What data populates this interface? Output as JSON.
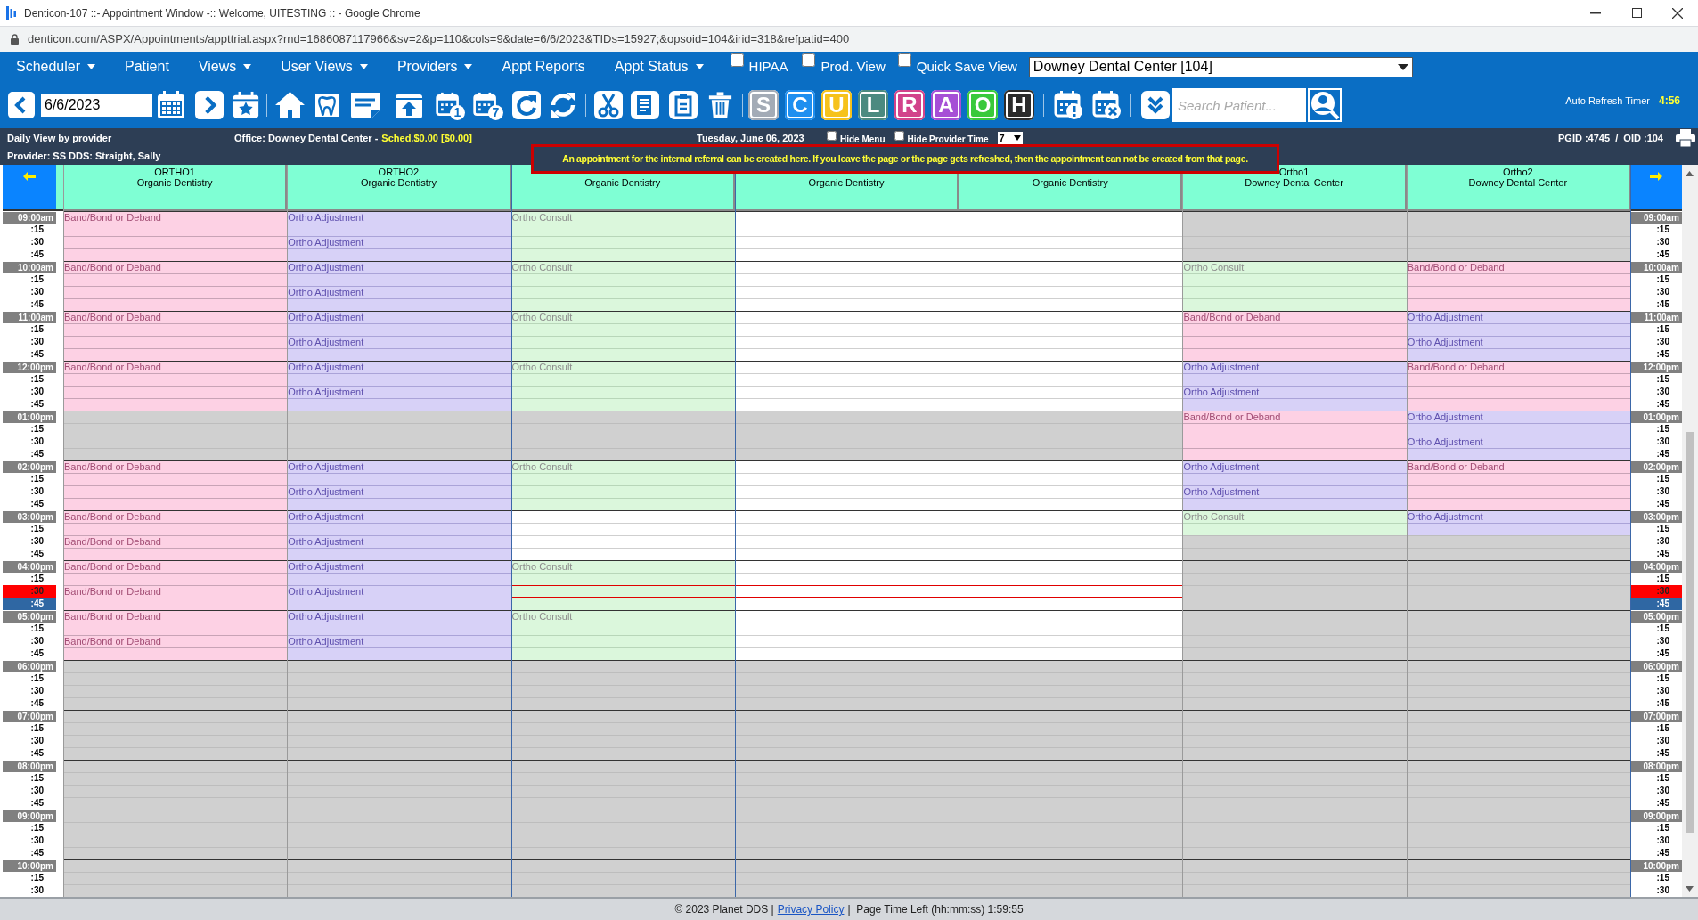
{
  "window": {
    "title": "Denticon-107 ::- Appointment Window -:: Welcome, UITESTING :: - Google Chrome",
    "url": "denticon.com/ASPX/Appointments/appttrial.aspx?rnd=1686087117966&sv=2&p=110&cols=9&date=6/6/2023&TIDs=15927;&opsoid=104&irid=318&refpatid=400"
  },
  "menu": [
    {
      "label": "Scheduler",
      "dropdown": true
    },
    {
      "label": "Patient",
      "dropdown": false
    },
    {
      "label": "Views",
      "dropdown": true
    },
    {
      "label": "User Views",
      "dropdown": true
    },
    {
      "label": "Providers",
      "dropdown": true
    },
    {
      "label": "Appt Reports",
      "dropdown": false
    },
    {
      "label": "Appt Status",
      "dropdown": true
    }
  ],
  "menu_checks": [
    {
      "label": "HIPAA",
      "checked": false
    },
    {
      "label": "Prod. View",
      "checked": false
    },
    {
      "label": "Quick Save View",
      "checked": false
    }
  ],
  "office_select": {
    "value": "Downey Dental Center [104]"
  },
  "toolbar": {
    "date": "6/6/2023",
    "day_badges": [
      "1",
      "7"
    ],
    "letters": [
      {
        "letter": "S",
        "color": "#a3abb6"
      },
      {
        "letter": "C",
        "color": "#1e8ff0"
      },
      {
        "letter": "U",
        "color": "#f6c21c"
      },
      {
        "letter": "L",
        "color": "#4b8a80"
      },
      {
        "letter": "R",
        "color": "#d2438b"
      },
      {
        "letter": "A",
        "color": "#a64fd6"
      },
      {
        "letter": "O",
        "color": "#39c93c"
      },
      {
        "letter": "H",
        "color": "#2b2b2b"
      }
    ],
    "search": {
      "placeholder": "Search Patient..."
    },
    "refresh_label": "Auto Refresh Timer",
    "refresh_value": "4:56"
  },
  "info": {
    "view": "Daily View by provider",
    "office": "Office: Downey Dental Center -",
    "sched": "Sched.$0.00 [$0.00]",
    "date": "Tuesday, June 06, 2023",
    "options": [
      {
        "label": "Hide Menu",
        "checked": false
      },
      {
        "label": "Hide Provider Time",
        "checked": false
      }
    ],
    "days": "7",
    "ids": "PGID :4745  /  OID :104",
    "provider": "Provider: SS DDS: Straight, Sally",
    "notice": "An appointment for the internal referral can be created here. If you leave the page or the page gets refreshed, then the appointment can not be created from that page."
  },
  "time_columns": [
    {
      "kind": "left",
      "hours": [
        {
          "label": "09:00am",
          "subs": [
            {
              "label": ":15",
              "kind": "plain"
            },
            {
              "label": ":30",
              "kind": "plain"
            },
            {
              "label": ":45",
              "kind": "plain"
            }
          ]
        },
        {
          "label": "10:00am",
          "subs": [
            {
              "label": ":15",
              "kind": "plain"
            },
            {
              "label": ":30",
              "kind": "plain"
            },
            {
              "label": ":45",
              "kind": "plain"
            }
          ]
        },
        {
          "label": "11:00am",
          "subs": [
            {
              "label": ":15",
              "kind": "plain"
            },
            {
              "label": ":30",
              "kind": "plain"
            },
            {
              "label": ":45",
              "kind": "plain"
            }
          ]
        },
        {
          "label": "12:00pm",
          "subs": [
            {
              "label": ":15",
              "kind": "plain"
            },
            {
              "label": ":30",
              "kind": "plain"
            },
            {
              "label": ":45",
              "kind": "plain"
            }
          ]
        },
        {
          "label": "01:00pm",
          "subs": [
            {
              "label": ":15",
              "kind": "plain"
            },
            {
              "label": ":30",
              "kind": "plain"
            },
            {
              "label": ":45",
              "kind": "plain"
            }
          ]
        },
        {
          "label": "02:00pm",
          "subs": [
            {
              "label": ":15",
              "kind": "plain"
            },
            {
              "label": ":30",
              "kind": "plain"
            },
            {
              "label": ":45",
              "kind": "plain"
            }
          ]
        },
        {
          "label": "03:00pm",
          "subs": [
            {
              "label": ":15",
              "kind": "plain"
            },
            {
              "label": ":30",
              "kind": "plain"
            },
            {
              "label": ":45",
              "kind": "plain"
            }
          ]
        },
        {
          "label": "04:00pm",
          "subs": [
            {
              "label": ":15",
              "kind": "plain"
            },
            {
              "label": ":30",
              "kind": "now"
            },
            {
              "label": ":45",
              "kind": "next"
            }
          ]
        },
        {
          "label": "05:00pm",
          "subs": [
            {
              "label": ":15",
              "kind": "plain"
            },
            {
              "label": ":30",
              "kind": "plain"
            },
            {
              "label": ":45",
              "kind": "plain"
            }
          ]
        },
        {
          "label": "06:00pm",
          "subs": [
            {
              "label": ":15",
              "kind": "plain"
            },
            {
              "label": ":30",
              "kind": "plain"
            },
            {
              "label": ":45",
              "kind": "plain"
            }
          ]
        },
        {
          "label": "07:00pm",
          "subs": [
            {
              "label": ":15",
              "kind": "plain"
            },
            {
              "label": ":30",
              "kind": "plain"
            },
            {
              "label": ":45",
              "kind": "plain"
            }
          ]
        },
        {
          "label": "08:00pm",
          "subs": [
            {
              "label": ":15",
              "kind": "plain"
            },
            {
              "label": ":30",
              "kind": "plain"
            },
            {
              "label": ":45",
              "kind": "plain"
            }
          ]
        },
        {
          "label": "09:00pm",
          "subs": [
            {
              "label": ":15",
              "kind": "plain"
            },
            {
              "label": ":30",
              "kind": "plain"
            },
            {
              "label": ":45",
              "kind": "plain"
            }
          ]
        },
        {
          "label": "10:00pm",
          "subs": [
            {
              "label": ":15",
              "kind": "plain"
            },
            {
              "label": ":30",
              "kind": "plain"
            }
          ]
        }
      ]
    },
    {
      "kind": "right",
      "hours": [
        {
          "label": "09:00am",
          "subs": [
            {
              "label": ":15",
              "kind": "plain"
            },
            {
              "label": ":30",
              "kind": "plain"
            },
            {
              "label": ":45",
              "kind": "plain"
            }
          ]
        },
        {
          "label": "10:00am",
          "subs": [
            {
              "label": ":15",
              "kind": "plain"
            },
            {
              "label": ":30",
              "kind": "plain"
            },
            {
              "label": ":45",
              "kind": "plain"
            }
          ]
        },
        {
          "label": "11:00am",
          "subs": [
            {
              "label": ":15",
              "kind": "plain"
            },
            {
              "label": ":30",
              "kind": "plain"
            },
            {
              "label": ":45",
              "kind": "plain"
            }
          ]
        },
        {
          "label": "12:00pm",
          "subs": [
            {
              "label": ":15",
              "kind": "plain"
            },
            {
              "label": ":30",
              "kind": "plain"
            },
            {
              "label": ":45",
              "kind": "plain"
            }
          ]
        },
        {
          "label": "01:00pm",
          "subs": [
            {
              "label": ":15",
              "kind": "plain"
            },
            {
              "label": ":30",
              "kind": "plain"
            },
            {
              "label": ":45",
              "kind": "plain"
            }
          ]
        },
        {
          "label": "02:00pm",
          "subs": [
            {
              "label": ":15",
              "kind": "plain"
            },
            {
              "label": ":30",
              "kind": "plain"
            },
            {
              "label": ":45",
              "kind": "plain"
            }
          ]
        },
        {
          "label": "03:00pm",
          "subs": [
            {
              "label": ":15",
              "kind": "plain"
            },
            {
              "label": ":30",
              "kind": "plain"
            },
            {
              "label": ":45",
              "kind": "plain"
            }
          ]
        },
        {
          "label": "04:00pm",
          "subs": [
            {
              "label": ":15",
              "kind": "plain"
            },
            {
              "label": ":30",
              "kind": "now"
            },
            {
              "label": ":45",
              "kind": "next"
            }
          ]
        },
        {
          "label": "05:00pm",
          "subs": [
            {
              "label": ":15",
              "kind": "plain"
            },
            {
              "label": ":30",
              "kind": "plain"
            },
            {
              "label": ":45",
              "kind": "plain"
            }
          ]
        },
        {
          "label": "06:00pm",
          "subs": [
            {
              "label": ":15",
              "kind": "plain"
            },
            {
              "label": ":30",
              "kind": "plain"
            },
            {
              "label": ":45",
              "kind": "plain"
            }
          ]
        },
        {
          "label": "07:00pm",
          "subs": [
            {
              "label": ":15",
              "kind": "plain"
            },
            {
              "label": ":30",
              "kind": "plain"
            },
            {
              "label": ":45",
              "kind": "plain"
            }
          ]
        },
        {
          "label": "08:00pm",
          "subs": [
            {
              "label": ":15",
              "kind": "plain"
            },
            {
              "label": ":30",
              "kind": "plain"
            },
            {
              "label": ":45",
              "kind": "plain"
            }
          ]
        },
        {
          "label": "09:00pm",
          "subs": [
            {
              "label": ":15",
              "kind": "plain"
            },
            {
              "label": ":30",
              "kind": "plain"
            },
            {
              "label": ":45",
              "kind": "plain"
            }
          ]
        },
        {
          "label": "10:00pm",
          "subs": [
            {
              "label": ":15",
              "kind": "plain"
            },
            {
              "label": ":30",
              "kind": "plain"
            }
          ]
        }
      ]
    }
  ],
  "columns": [
    {
      "name": "ORTHO1",
      "office": "Organic Dentistry",
      "hours": [
        {
          "kind": "band",
          "top": "Band/Bond or Deband"
        },
        {
          "kind": "band",
          "top": "Band/Bond or Deband"
        },
        {
          "kind": "band",
          "top": "Band/Bond or Deband"
        },
        {
          "kind": "band",
          "top": "Band/Bond or Deband"
        },
        {
          "kind": "closed"
        },
        {
          "kind": "band",
          "top": "Band/Bond or Deband"
        },
        {
          "kind": "band",
          "top": "Band/Bond or Deband",
          "half": "Band/Bond or Deband"
        },
        {
          "kind": "band",
          "top": "Band/Bond or Deband",
          "half": "Band/Bond or Deband"
        },
        {
          "kind": "band",
          "top": "Band/Bond or Deband",
          "half": "Band/Bond or Deband"
        },
        {
          "kind": "closed"
        },
        {
          "kind": "closed"
        },
        {
          "kind": "closed"
        },
        {
          "kind": "closed"
        },
        {
          "kind": "closed"
        }
      ]
    },
    {
      "name": "ORTHO2",
      "office": "Organic Dentistry",
      "hours": [
        {
          "kind": "adjust",
          "top": "Ortho Adjustment",
          "half": "Ortho Adjustment"
        },
        {
          "kind": "adjust",
          "top": "Ortho Adjustment",
          "half": "Ortho Adjustment"
        },
        {
          "kind": "adjust",
          "top": "Ortho Adjustment",
          "half": "Ortho Adjustment"
        },
        {
          "kind": "adjust",
          "top": "Ortho Adjustment",
          "half": "Ortho Adjustment"
        },
        {
          "kind": "closed"
        },
        {
          "kind": "adjust",
          "top": "Ortho Adjustment",
          "half": "Ortho Adjustment"
        },
        {
          "kind": "adjust",
          "top": "Ortho Adjustment",
          "half": "Ortho Adjustment"
        },
        {
          "kind": "adjust",
          "top": "Ortho Adjustment",
          "half": "Ortho Adjustment"
        },
        {
          "kind": "adjust",
          "top": "Ortho Adjustment",
          "half": "Ortho Adjustment"
        },
        {
          "kind": "closed"
        },
        {
          "kind": "closed"
        },
        {
          "kind": "closed"
        },
        {
          "kind": "closed"
        },
        {
          "kind": "closed"
        }
      ]
    },
    {
      "office": "Organic Dentistry",
      "hours": [
        {
          "kind": "consult",
          "top": "Ortho Consult"
        },
        {
          "kind": "consult",
          "top": "Ortho Consult"
        },
        {
          "kind": "consult",
          "top": "Ortho Consult"
        },
        {
          "kind": "consult",
          "top": "Ortho Consult"
        },
        {
          "kind": "closed"
        },
        {
          "kind": "consult",
          "top": "Ortho Consult"
        },
        {
          "kind": "open"
        },
        {
          "kind": "consult",
          "top": "Ortho Consult"
        },
        {
          "kind": "consult",
          "top": "Ortho Consult"
        },
        {
          "kind": "closed"
        },
        {
          "kind": "closed"
        },
        {
          "kind": "closed"
        },
        {
          "kind": "closed"
        },
        {
          "kind": "closed"
        }
      ]
    },
    {
      "office": "Organic Dentistry",
      "hours": [
        {
          "kind": "open"
        },
        {
          "kind": "open"
        },
        {
          "kind": "open"
        },
        {
          "kind": "open"
        },
        {
          "kind": "closed"
        },
        {
          "kind": "open"
        },
        {
          "kind": "open"
        },
        {
          "kind": "open"
        },
        {
          "kind": "open"
        },
        {
          "kind": "closed"
        },
        {
          "kind": "closed"
        },
        {
          "kind": "closed"
        },
        {
          "kind": "closed"
        },
        {
          "kind": "closed"
        }
      ]
    },
    {
      "office": "Organic Dentistry",
      "hours": [
        {
          "kind": "open"
        },
        {
          "kind": "open"
        },
        {
          "kind": "open"
        },
        {
          "kind": "open"
        },
        {
          "kind": "closed"
        },
        {
          "kind": "open"
        },
        {
          "kind": "open"
        },
        {
          "kind": "open"
        },
        {
          "kind": "open"
        },
        {
          "kind": "closed"
        },
        {
          "kind": "closed"
        },
        {
          "kind": "closed"
        },
        {
          "kind": "closed"
        },
        {
          "kind": "closed"
        }
      ]
    },
    {
      "name": "Ortho1",
      "office": "Downey Dental Center",
      "hours": [
        {
          "kind": "closed"
        },
        {
          "kind": "consult",
          "top": "Ortho Consult"
        },
        {
          "kind": "band",
          "top": "Band/Bond or Deband"
        },
        {
          "kind": "adjust",
          "top": "Ortho Adjustment",
          "half": "Ortho Adjustment"
        },
        {
          "kind": "band",
          "top": "Band/Bond or Deband"
        },
        {
          "kind": "adjust",
          "top": "Ortho Adjustment",
          "half": "Ortho Adjustment"
        },
        {
          "kind": "split",
          "parts": [
            {
              "kind": "consult",
              "top": "Ortho Consult"
            },
            {
              "kind": "closed"
            }
          ]
        },
        {
          "kind": "closed"
        },
        {
          "kind": "closed"
        },
        {
          "kind": "closed"
        },
        {
          "kind": "closed"
        },
        {
          "kind": "closed"
        },
        {
          "kind": "closed"
        },
        {
          "kind": "closed"
        }
      ]
    },
    {
      "name": "Ortho2",
      "office": "Downey Dental Center",
      "hours": [
        {
          "kind": "closed"
        },
        {
          "kind": "band",
          "top": "Band/Bond or Deband"
        },
        {
          "kind": "adjust",
          "top": "Ortho Adjustment",
          "half": "Ortho Adjustment"
        },
        {
          "kind": "band",
          "top": "Band/Bond or Deband"
        },
        {
          "kind": "adjust",
          "top": "Ortho Adjustment",
          "half": "Ortho Adjustment"
        },
        {
          "kind": "band",
          "top": "Band/Bond or Deband"
        },
        {
          "kind": "split",
          "parts": [
            {
              "kind": "adjust",
              "top": "Ortho Adjustment"
            },
            {
              "kind": "closed"
            }
          ]
        },
        {
          "kind": "closed"
        },
        {
          "kind": "closed"
        },
        {
          "kind": "closed"
        },
        {
          "kind": "closed"
        },
        {
          "kind": "closed"
        },
        {
          "kind": "closed"
        },
        {
          "kind": "closed"
        }
      ]
    }
  ],
  "footer": {
    "copyright": "© 2023 Planet DDS |",
    "link": "Privacy Policy",
    "timer": "|  Page Time Left (hh:mm:ss) 1:59:55"
  }
}
